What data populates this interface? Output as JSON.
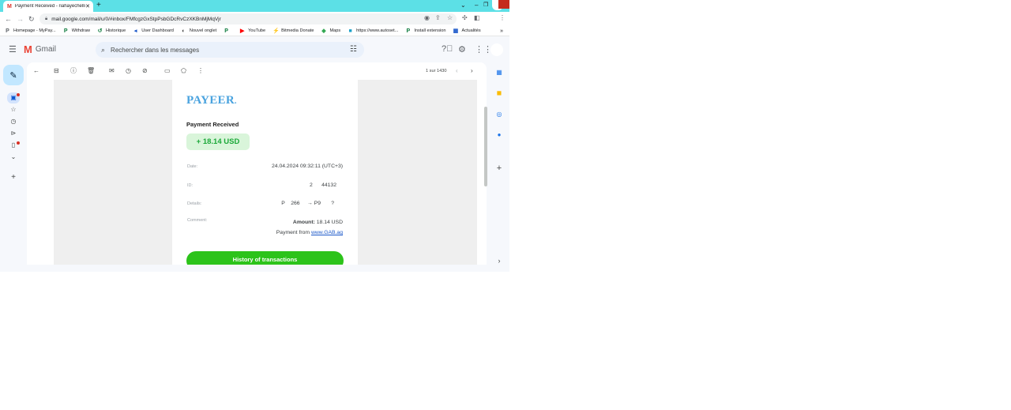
{
  "browser": {
    "tab_title": "Payment Received - riahayechelli",
    "tab_favicon": "M",
    "new_tab": "+",
    "url": "mail.google.com/mail/u/0/#inbox/FMfcgzGxStpPsbGDcRvCzXKBnMjMqVjr",
    "bookmarks": [
      {
        "label": "Homepage - MyPay...",
        "icon": "P"
      },
      {
        "label": "Withdraw",
        "icon": "P"
      },
      {
        "label": "Historique",
        "icon": "↺"
      },
      {
        "label": "User Dashboard",
        "icon": "◂"
      },
      {
        "label": "Nouvel onglet",
        "icon": "◐"
      },
      {
        "label": "",
        "icon": "P"
      },
      {
        "label": "YouTube",
        "icon": "▶"
      },
      {
        "label": "Bitmedia Donate",
        "icon": "⚡"
      },
      {
        "label": "Maps",
        "icon": "◆"
      },
      {
        "label": "https://www.autoset...",
        "icon": "■"
      },
      {
        "label": "Install extension",
        "icon": "P"
      },
      {
        "label": "Actualités",
        "icon": "▦"
      }
    ],
    "bookmarks_more": "»"
  },
  "gmail": {
    "logo_text": "Gmail",
    "search_placeholder": "Rechercher dans les messages",
    "pager_text": "1 sur 1430"
  },
  "email": {
    "brand": "PAYEER",
    "brand_dot": ".",
    "heading": "Payment Received",
    "amount_badge": "+ 18.14 USD",
    "rows": {
      "date_label": "Date:",
      "date_value": "24.04.2024 09:32:11 (UTC+3)",
      "id_label": "ID:",
      "id_value": "2      44132",
      "details_label": "Details:",
      "details_value": "P    266     → P9       ?",
      "comment_label": "Comment:",
      "amount_label": "Amount:",
      "amount_value": " 18.14 USD",
      "payment_from_label": "Payment from ",
      "payment_from_link": "www.GAB.ag"
    },
    "history_button": "History of transactions"
  },
  "colors": {
    "tabstrip": "#5ce0e6",
    "payeer_blue": "#4aa3df",
    "badge_bg": "#d9f5da",
    "badge_text": "#1aa838",
    "history_button": "#2cc31a",
    "compose_bg": "#c2e7ff"
  }
}
